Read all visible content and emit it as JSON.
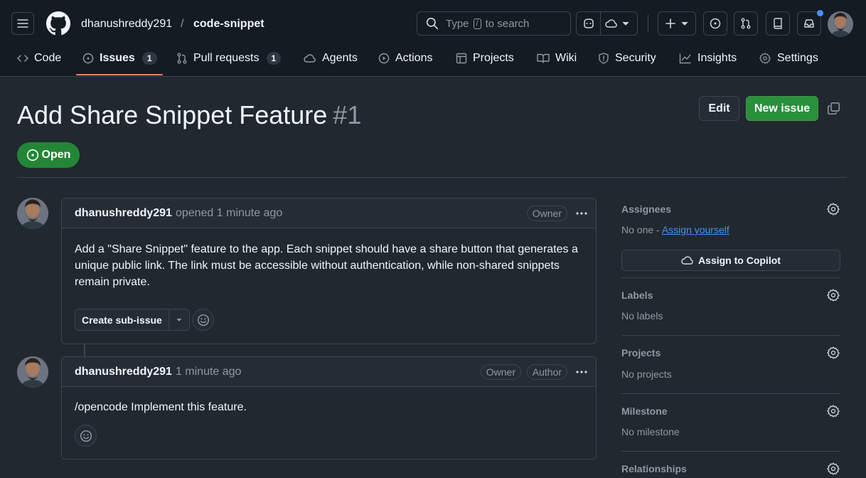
{
  "header": {
    "owner": "dhanushreddy291",
    "separator": "/",
    "repo": "code-snippet",
    "search": {
      "prefix": "Type",
      "key": "/",
      "suffix": "to search"
    }
  },
  "nav": {
    "tabs": [
      {
        "label": "Code"
      },
      {
        "label": "Issues",
        "count": "1",
        "selected": true
      },
      {
        "label": "Pull requests",
        "count": "1"
      },
      {
        "label": "Agents"
      },
      {
        "label": "Actions"
      },
      {
        "label": "Projects"
      },
      {
        "label": "Wiki"
      },
      {
        "label": "Security"
      },
      {
        "label": "Insights"
      },
      {
        "label": "Settings"
      }
    ]
  },
  "issue": {
    "title": "Add Share Snippet Feature",
    "number": "#1",
    "state": "Open",
    "edit_label": "Edit",
    "new_issue_label": "New issue"
  },
  "comments": [
    {
      "author": "dhanushreddy291",
      "meta": "opened 1 minute ago",
      "badges": [
        "Owner"
      ],
      "body": "Add a \"Share Snippet\" feature to the app. Each snippet should have a share button that generates a unique public link. The link must be accessible without authentication, while non-shared snippets remain private.",
      "sub_issue_label": "Create sub-issue"
    },
    {
      "author": "dhanushreddy291",
      "meta": "1 minute ago",
      "badges": [
        "Owner",
        "Author"
      ],
      "body": "/opencode Implement this feature."
    }
  ],
  "sidebar": {
    "assignees": {
      "heading": "Assignees",
      "value": "No one - ",
      "link": "Assign yourself",
      "copilot": "Assign to Copilot"
    },
    "labels": {
      "heading": "Labels",
      "value": "No labels"
    },
    "projects": {
      "heading": "Projects",
      "value": "No projects"
    },
    "milestone": {
      "heading": "Milestone",
      "value": "No milestone"
    },
    "relationships": {
      "heading": "Relationships"
    }
  },
  "colors": {
    "open_green": "#238636",
    "accent_blue": "#4493f8",
    "tab_underline": "#f78166",
    "notification_dot": "#4493f8"
  }
}
